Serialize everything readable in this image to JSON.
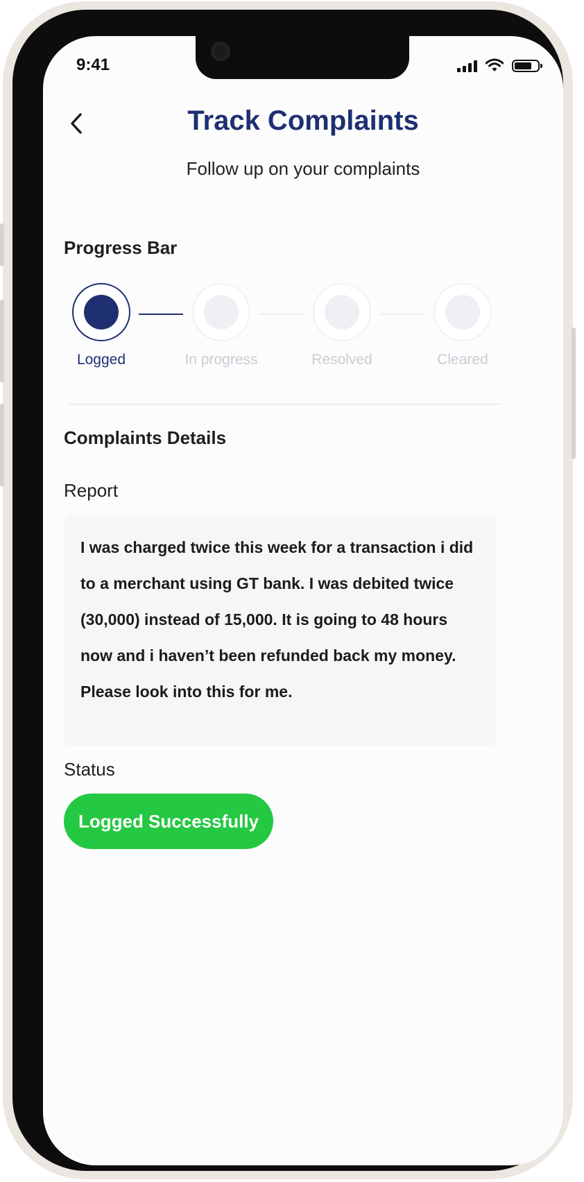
{
  "status_bar": {
    "time": "9:41"
  },
  "header": {
    "title": "Track Complaints",
    "subtitle": "Follow up on your complaints"
  },
  "progress": {
    "heading": "Progress Bar",
    "steps": [
      {
        "label": "Logged",
        "state": "active"
      },
      {
        "label": "In progress",
        "state": "inactive"
      },
      {
        "label": "Resolved",
        "state": "inactive"
      },
      {
        "label": "Cleared",
        "state": "inactive"
      }
    ]
  },
  "details": {
    "heading": "Complaints Details",
    "report_label": "Report",
    "report_lines": [
      "I was charged twice this week for a transaction i did",
      "to a merchant using GT bank. I was debited twice",
      "(30,000) instead of 15,000. It is going to 48 hours",
      "now and i haven’t been refunded back my money.",
      "Please look into this for me."
    ],
    "status_label": "Status",
    "status_value": "Logged Successfully"
  },
  "colors": {
    "primary": "#1e2f72",
    "success": "#25c842",
    "inactive": "#c7ccd6"
  },
  "icons": [
    "back-arrow-icon",
    "signal-icon",
    "wifi-icon",
    "battery-icon"
  ]
}
